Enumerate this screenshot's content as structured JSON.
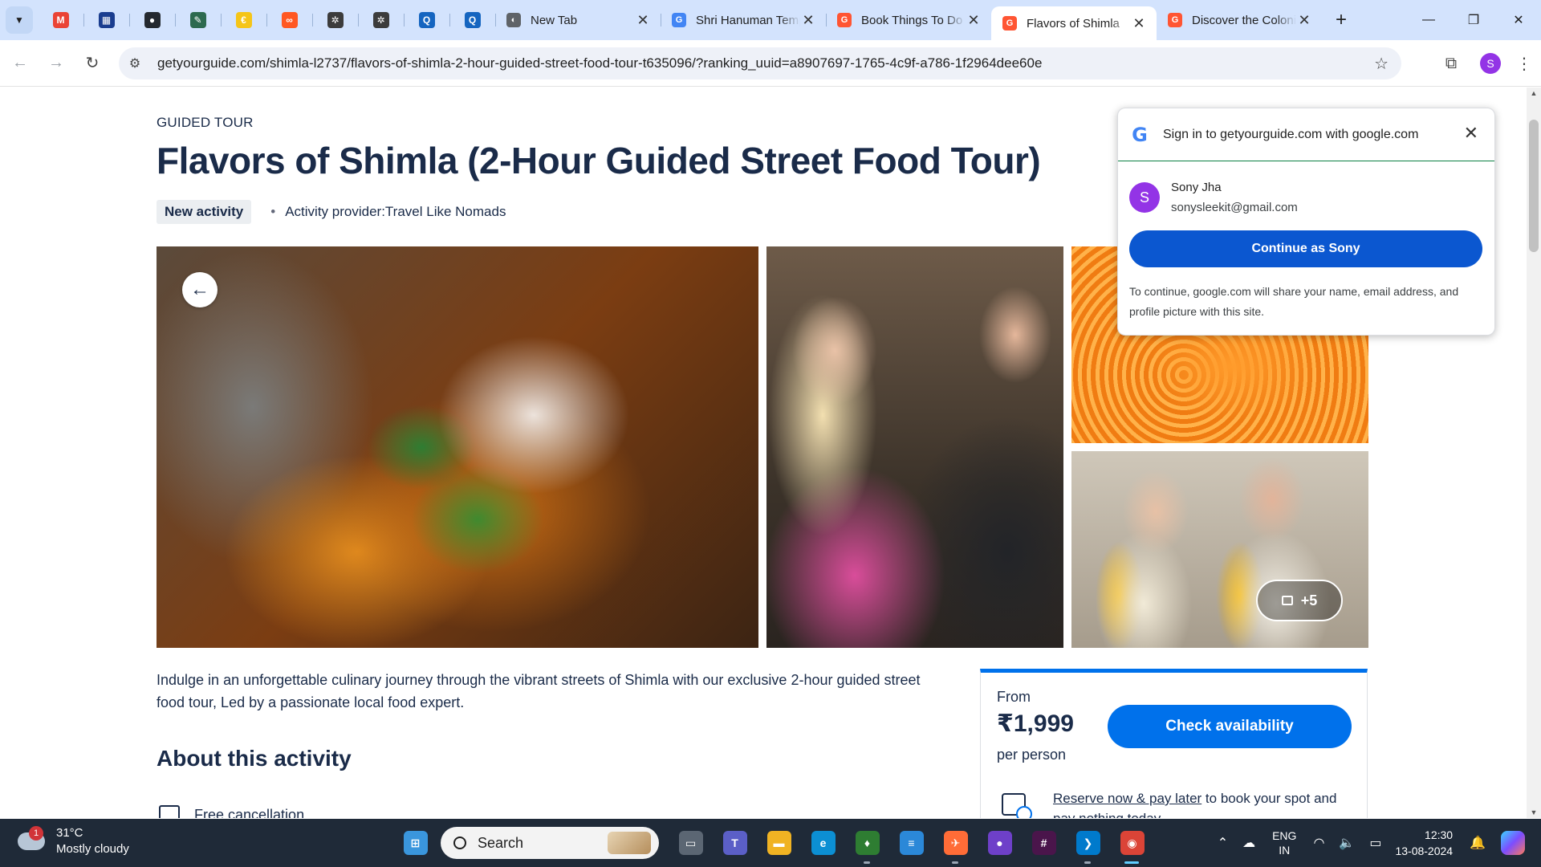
{
  "browser": {
    "pinned_tabs": [
      {
        "icon": "gmail-icon",
        "color": "#ea4335",
        "glyph": "M"
      },
      {
        "icon": "dashboard-icon",
        "color": "#1a3d8f",
        "glyph": "▦"
      },
      {
        "icon": "github-icon",
        "color": "#24292f",
        "glyph": "●"
      },
      {
        "icon": "app-icon",
        "color": "#2d6a4f",
        "glyph": "✎"
      },
      {
        "icon": "coin-icon",
        "color": "#f5c518",
        "glyph": "€"
      },
      {
        "icon": "link-app-icon",
        "color": "#ff5722",
        "glyph": "∞"
      },
      {
        "icon": "chatgpt-icon",
        "color": "#3c3c3c",
        "glyph": "✲"
      },
      {
        "icon": "chatgpt-icon",
        "color": "#3c3c3c",
        "glyph": "✲"
      },
      {
        "icon": "search-q-icon",
        "color": "#1565c0",
        "glyph": "Q"
      },
      {
        "icon": "search-q-icon",
        "color": "#1565c0",
        "glyph": "Q"
      }
    ],
    "tabs": [
      {
        "title": "New Tab",
        "icon": "chrome-icon",
        "color": "#5f6368",
        "glyph": "◐",
        "active": false
      },
      {
        "title": "Shri Hanuman Temple",
        "icon": "google-icon",
        "color": "#4285f4",
        "glyph": "G",
        "active": false
      },
      {
        "title": "Book Things To Do",
        "icon": "getyourguide-icon",
        "color": "#ff5533",
        "glyph": "G",
        "active": false
      },
      {
        "title": "Flavors of Shimla",
        "icon": "getyourguide-icon",
        "color": "#ff5533",
        "glyph": "G",
        "active": true
      },
      {
        "title": "Discover the Colonial",
        "icon": "getyourguide-icon",
        "color": "#ff5533",
        "glyph": "G",
        "active": false
      }
    ],
    "url": "getyourguide.com/shimla-l2737/flavors-of-shimla-2-hour-guided-street-food-tour-t635096/?ranking_uuid=a8907697-1765-4c9f-a786-1f2964dee60e",
    "profile_initial": "S"
  },
  "activity": {
    "kicker": "GUIDED TOUR",
    "title": "Flavors of Shimla (2-Hour Guided Street Food Tour)",
    "badge": "New activity",
    "provider_label": "Activity provider:",
    "provider_name": "Travel Like Nomads",
    "more_photos": "+5",
    "description": "Indulge in an unforgettable culinary journey through the vibrant streets of Shimla with our exclusive 2-hour guided street food tour, Led by a passionate local food expert.",
    "about_heading": "About this activity",
    "feature_1": "Free cancellation"
  },
  "booking": {
    "from_label": "From",
    "price": "₹1,999",
    "per_label": "per person",
    "cta": "Check availability",
    "reserve_link": "Reserve now & pay later",
    "reserve_rest": " to book your spot and pay nothing today"
  },
  "google_signin": {
    "header": "Sign in to getyourguide.com with google.com",
    "name": "Sony Jha",
    "email": "sonysleekit@gmail.com",
    "initial": "S",
    "button": "Continue as Sony",
    "note": "To continue, google.com will share your name, email address, and profile picture with this site."
  },
  "taskbar": {
    "temperature": "31°C",
    "condition": "Mostly cloudy",
    "alert_count": "1",
    "search_placeholder": "Search",
    "lang_top": "ENG",
    "lang_bottom": "IN",
    "time": "12:30",
    "date": "13-08-2024",
    "apps": [
      {
        "name": "start-button",
        "icon": "windows-icon",
        "color": "#3a96dd",
        "glyph": "⊞",
        "run": false
      },
      {
        "name": "task-view-button",
        "icon": "task-view-icon",
        "color": "#5b6673",
        "glyph": "▭",
        "run": false
      },
      {
        "name": "teams-app",
        "icon": "teams-icon",
        "color": "#5b5fc7",
        "glyph": "T",
        "run": false
      },
      {
        "name": "file-explorer-app",
        "icon": "folder-icon",
        "color": "#f0b323",
        "glyph": "▬",
        "run": false
      },
      {
        "name": "edge-app",
        "icon": "edge-icon",
        "color": "#0c8fd3",
        "glyph": "e",
        "run": false
      },
      {
        "name": "mongodb-app",
        "icon": "leaf-icon",
        "color": "#2e7d32",
        "glyph": "♦",
        "run": true
      },
      {
        "name": "notepad-app",
        "icon": "notepad-icon",
        "color": "#2b88d8",
        "glyph": "≡",
        "run": false
      },
      {
        "name": "postman-app",
        "icon": "postman-icon",
        "color": "#ff6c37",
        "glyph": "✈",
        "run": true
      },
      {
        "name": "github-desktop-app",
        "icon": "github-icon",
        "color": "#6e40c9",
        "glyph": "●",
        "run": false
      },
      {
        "name": "slack-app",
        "icon": "slack-icon",
        "color": "#4a154b",
        "glyph": "#",
        "run": false
      },
      {
        "name": "vscode-app",
        "icon": "vscode-icon",
        "color": "#007acc",
        "glyph": "❯",
        "run": true
      },
      {
        "name": "chrome-app",
        "icon": "chrome-icon",
        "color": "#db4437",
        "glyph": "◉",
        "run": true,
        "active": true
      }
    ]
  }
}
